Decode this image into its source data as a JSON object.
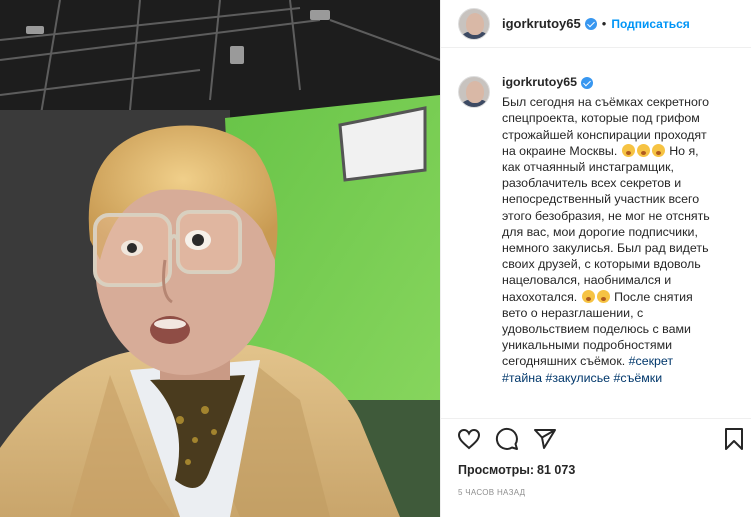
{
  "post": {
    "username": "igorkrutoy65",
    "dot": "•",
    "follow_label": "Подписаться",
    "caption_user": "igorkrutoy65",
    "caption_lines": [
      "Был сегодня на съёмках секретного",
      "спецпроекта, которые под грифом",
      "строжайшей конспирации проходят",
      "на окраине Москвы.",
      "Но я,",
      "как отчаянный инстаграмщик,",
      "разоблачитель всех секретов и",
      "непосредственный участник всего",
      "этого безобразия, не мог не отснять",
      "для вас, мои дорогие подписчики,",
      "немного закулисья. Был рад видеть",
      "своих друзей, с которыми вдоволь",
      "нацеловался, наобнимался и",
      "нахохотался.",
      "После снятия",
      "вето о неразглашении, с",
      "удовольствием поделюсь с вами",
      "уникальными подробностями",
      "сегодняшних съёмок."
    ],
    "tags": {
      "t1": "#секрет",
      "t2": "#тайна",
      "t3": "#закулисье",
      "t4": "#съёмки"
    },
    "views_label": "Просмотры:",
    "views_value": "81 073",
    "time_label": "5 ЧАСОВ НАЗАД"
  },
  "icons": [
    "heart-icon",
    "comment-icon",
    "share-icon",
    "bookmark-icon",
    "verified-icon"
  ],
  "colors": {
    "accent": "#0095f6",
    "verified": "#3897f0",
    "hashtag": "#00376b",
    "muted": "#8e8e8e",
    "green_screen": "#79cf52",
    "jacket": "#d7b57e"
  }
}
